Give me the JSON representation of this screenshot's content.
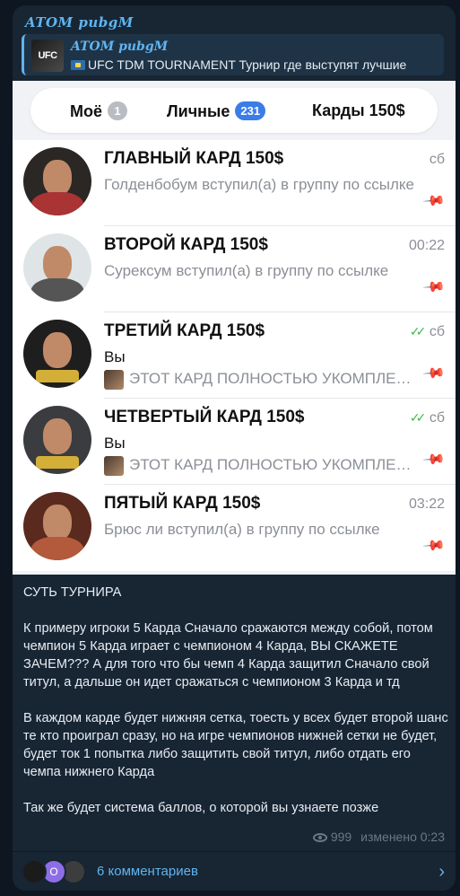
{
  "post": {
    "author": "ATOM pubgM",
    "reply": {
      "author": "ATOM pubgM",
      "thumb_text": "UFC",
      "text": "UFC TDM TOURNAMENT   Турнир где выступят лучшие"
    }
  },
  "screenshot": {
    "tabs": [
      {
        "label": "Моё",
        "badge": "1",
        "badge_color": "#b9bcc2"
      },
      {
        "label": "Личные",
        "badge": "231",
        "badge_color": "#3b7ce8"
      },
      {
        "label": "Карды 150$",
        "badge": null
      }
    ],
    "chats": [
      {
        "title": "ГЛАВНЫЙ КАРД 150$",
        "time": "сб",
        "read": false,
        "sender": null,
        "preview": "Голденбобум вступил(а) в группу по ссылке",
        "avatar_bg": "#2b2724",
        "body": "#a33"
      },
      {
        "title": "ВТОРОЙ КАРД 150$",
        "time": "00:22",
        "read": false,
        "sender": null,
        "preview": "Сурексум вступил(а) в группу по ссылке",
        "avatar_bg": "#dfe4e6",
        "body": "#555"
      },
      {
        "title": "ТРЕТИЙ КАРД 150$",
        "time": "сб",
        "read": true,
        "sender": "Вы",
        "preview": "ЭТОТ КАРД ПОЛНОСТЬЮ УКОМПЛЕКТОВАН",
        "avatar_bg": "#1e1e1e",
        "body": "#333"
      },
      {
        "title": "ЧЕТВЕРТЫЙ КАРД 150$",
        "time": "сб",
        "read": true,
        "sender": "Вы",
        "preview": "ЭТОТ КАРД ПОЛНОСТЬЮ УКОМПЛЕКТОВАН",
        "avatar_bg": "#3a3c40",
        "body": "#222"
      },
      {
        "title": "ПЯТЫЙ КАРД 150$",
        "time": "03:22",
        "read": false,
        "sender": null,
        "preview": "Брюс ли вступил(а) в группу по ссылке",
        "avatar_bg": "#5a2a1e",
        "body": "#b45a3c"
      }
    ]
  },
  "message": {
    "text": "СУТЬ ТУРНИРА\n\nК примеру игроки 5 Карда Сначало сражаются между собой, потом чемпион 5 Карда играет с чемпионом 4 Карда, ВЫ СКАЖЕТЕ ЗАЧЕМ??? А для того что бы  чемп 4 Карда защитил Сначало свой титул, а дальше он идет сражаться с чемпионом 3 Карда и тд\n\nВ каждом карде будет нижняя сетка, тоесть у всех будет второй шанс те кто проиграл сразу, но на игре чемпионов нижней сетки не будет, будет ток 1 попытка либо защитить свой титул, либо отдать его чемпа нижнего Карда\n\nТак же будет система баллов, о которой вы узнаете позже",
    "views": "999",
    "edited": "изменено 0:23"
  },
  "comments": {
    "label": "6 комментариев",
    "avatars": [
      {
        "color": "#1b1b1b",
        "letter": ""
      },
      {
        "color": "#8e6ee6",
        "letter": "O"
      },
      {
        "color": "#3d3d3d",
        "letter": ""
      }
    ]
  }
}
